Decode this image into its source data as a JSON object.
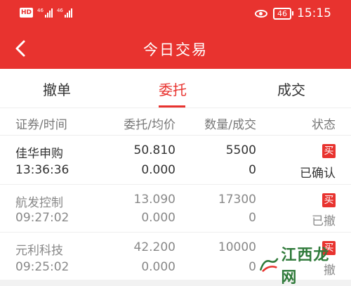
{
  "status_bar": {
    "hd_label": "HD",
    "signal1_label": "46",
    "signal2_label": "46",
    "battery": "46",
    "time": "15:15"
  },
  "header": {
    "title": "今日交易"
  },
  "tabs": [
    {
      "label": "撤单",
      "active": false
    },
    {
      "label": "委托",
      "active": true
    },
    {
      "label": "成交",
      "active": false
    }
  ],
  "table": {
    "columns": [
      "证券/时间",
      "委托/均价",
      "数量/成交",
      "状态"
    ],
    "rows": [
      {
        "name": "佳华申购",
        "time": "13:36:36",
        "price": "50.810",
        "avg": "0.000",
        "qty": "5500",
        "filled": "0",
        "side": "买",
        "status": "已确认"
      },
      {
        "name": "航发控制",
        "time": "09:27:02",
        "price": "13.090",
        "avg": "0.000",
        "qty": "17300",
        "filled": "0",
        "side": "买",
        "status": "已撤"
      },
      {
        "name": "元利科技",
        "time": "09:25:02",
        "price": "42.200",
        "avg": "0.000",
        "qty": "10000",
        "filled": "0",
        "side": "买",
        "status": "撤"
      }
    ]
  },
  "watermark": {
    "text": "江西龙网"
  },
  "colors": {
    "accent": "#e8332f",
    "watermark_green": "#2f7a3a"
  }
}
